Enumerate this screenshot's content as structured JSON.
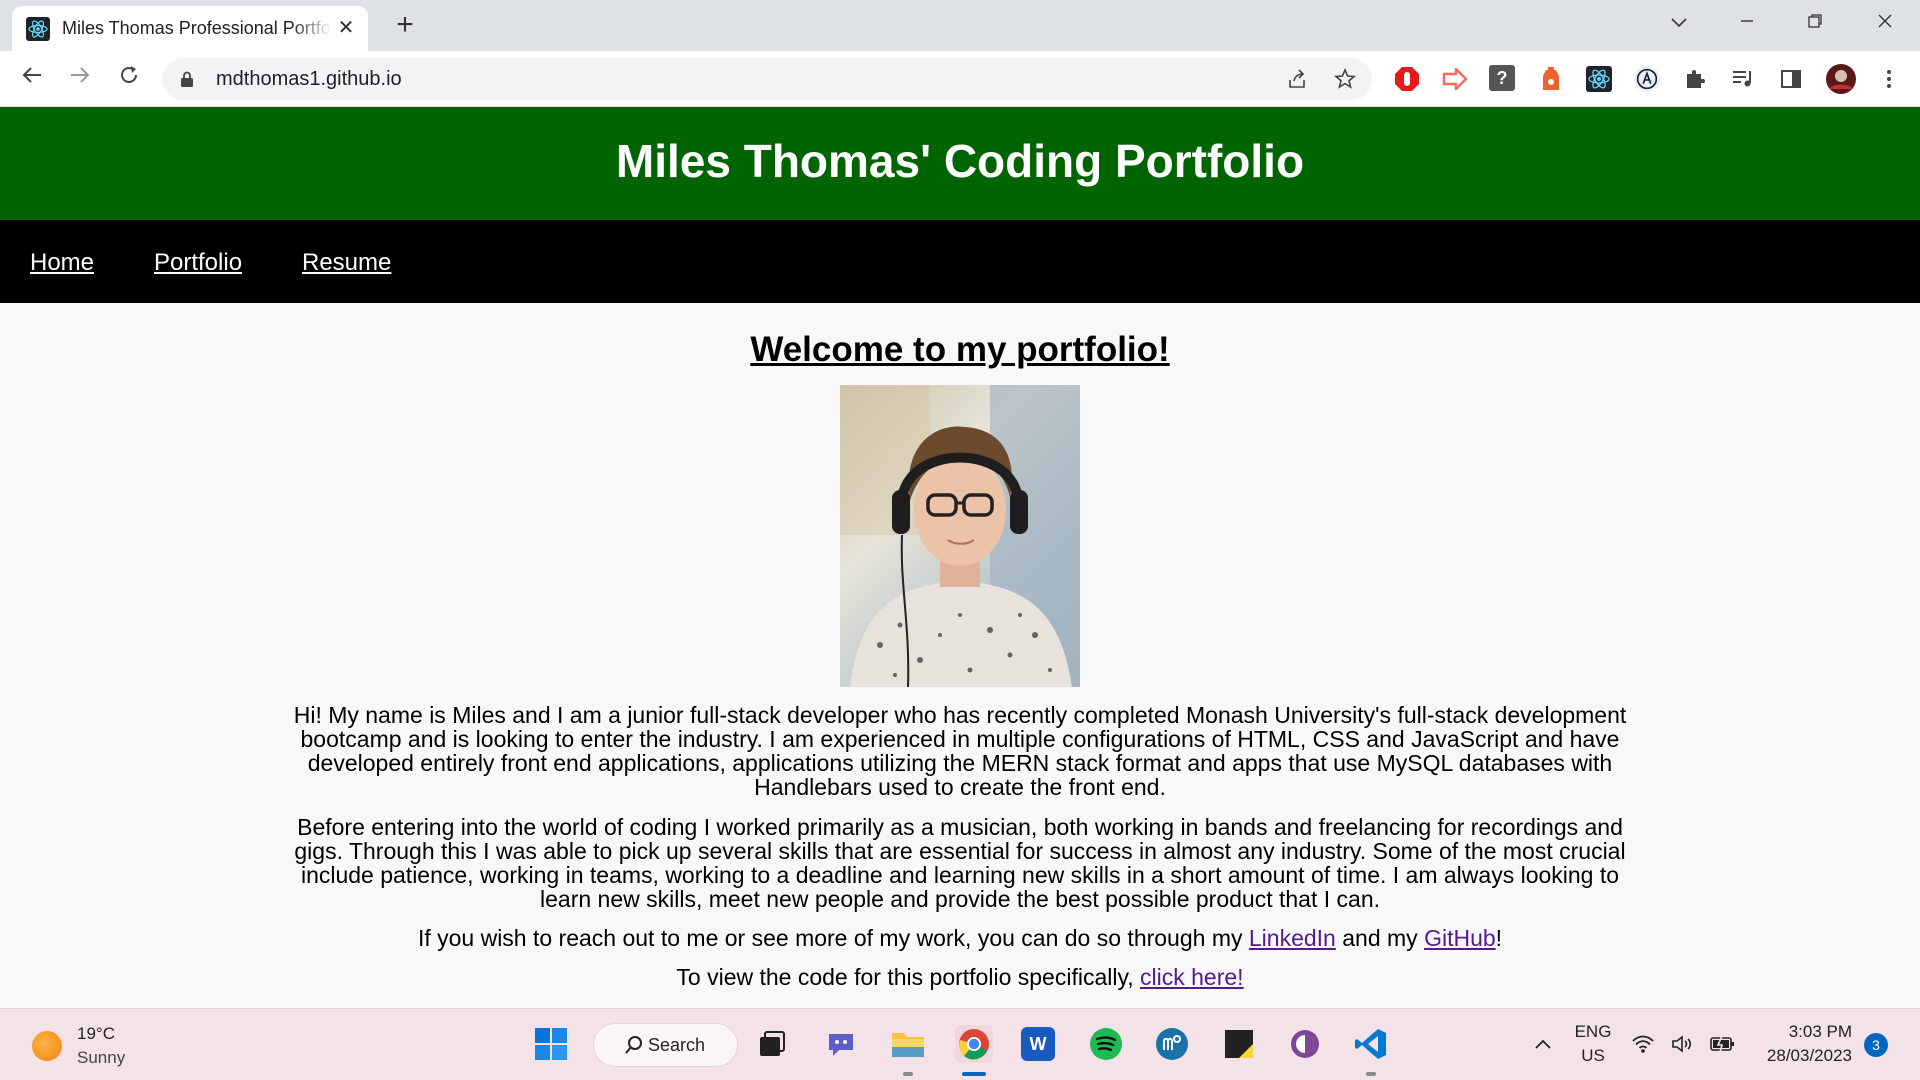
{
  "browser": {
    "tab_title": "Miles Thomas Professional Portfolio",
    "url": "mdthomas1.github.io",
    "new_tab_symbol": "+",
    "close_symbol": "✕"
  },
  "page": {
    "header_title": "Miles Thomas' Coding Portfolio",
    "nav": [
      {
        "label": "Home"
      },
      {
        "label": "Portfolio"
      },
      {
        "label": "Resume"
      }
    ],
    "welcome_heading": "Welcome to my portfolio!",
    "paragraph1": "Hi! My name is Miles and I am a junior full-stack developer who has recently completed Monash University's full-stack development bootcamp and is looking to enter the industry. I am experienced in multiple configurations of HTML, CSS and JavaScript and have developed entirely front end applications, applications utilizing the MERN stack format and apps that use MySQL databases with Handlebars used to create the front end.",
    "paragraph2": "Before entering into the world of coding I worked primarily as a musician, both working in bands and freelancing for recordings and gigs. Through this I was able to pick up several skills that are essential for success in almost any industry. Some of the most crucial include patience, working in teams, working to a deadline and learning new skills in a short amount of time. I am always looking to learn new skills, meet new people and provide the best possible product that I can.",
    "contact_prefix": "If you wish to reach out to me or see more of my work, you can do so through my ",
    "linkedin_label": "LinkedIn",
    "contact_middle": " and my ",
    "github_label": "GitHub",
    "contact_suffix": "!",
    "code_prefix": "To view the code for this portfolio specifically, ",
    "code_link_label": "click here!"
  },
  "taskbar": {
    "weather_temp": "19°C",
    "weather_condition": "Sunny",
    "search_label": "Search",
    "language_line1": "ENG",
    "language_line2": "US",
    "time": "3:03 PM",
    "date": "28/03/2023",
    "notification_count": "3"
  },
  "colors": {
    "header_bg": "#006400",
    "nav_bg": "#000000",
    "link_visited": "#551a8b"
  }
}
